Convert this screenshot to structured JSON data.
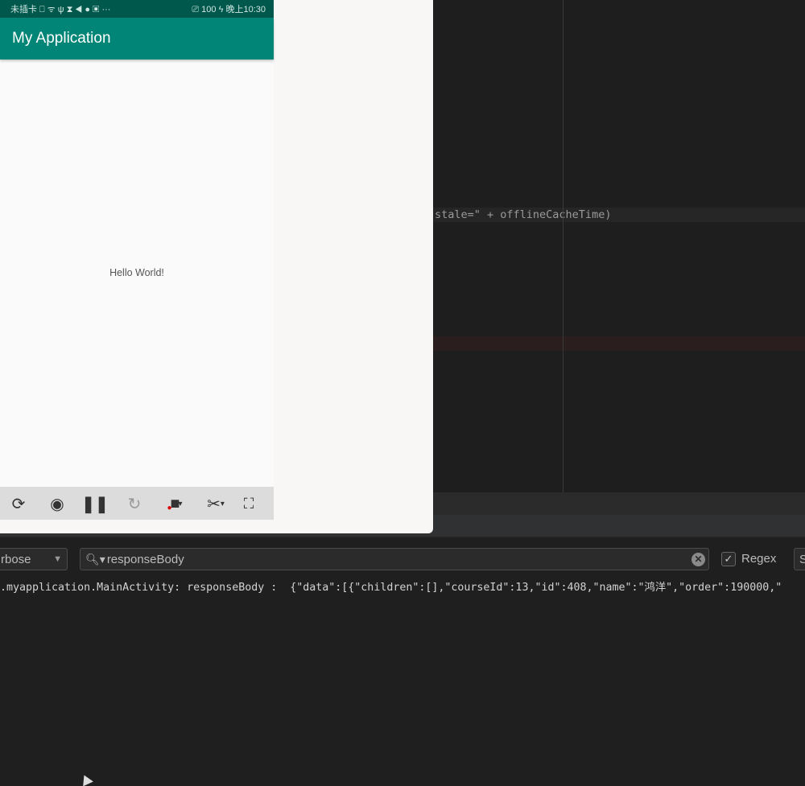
{
  "editor": {
    "code_line": "stale=\" + offlineCacheTime)"
  },
  "phone": {
    "status_left": "未插卡 ⎕ ᯤ ψ ⧗ ◀ ● ▣ ···",
    "status_right": "⎚ 100 ϟ 晚上10:30",
    "app_title": "My Application",
    "content": "Hello World!"
  },
  "emulator_toolbar": {
    "icons": [
      "rotate-icon",
      "screenshot-sd-icon",
      "pause-icon",
      "refresh-icon",
      "record-icon",
      "cut-icon",
      "fullscreen-icon"
    ]
  },
  "logcat": {
    "level": "rbose",
    "search_value": "responseBody",
    "regex_label": "Regex",
    "regex_checked": true,
    "next_field": "S",
    "log_line": ".myapplication.MainActivity: responseBody :  {\"data\":[{\"children\":[],\"courseId\":13,\"id\":408,\"name\":\"鸿洋\",\"order\":190000,\""
  }
}
